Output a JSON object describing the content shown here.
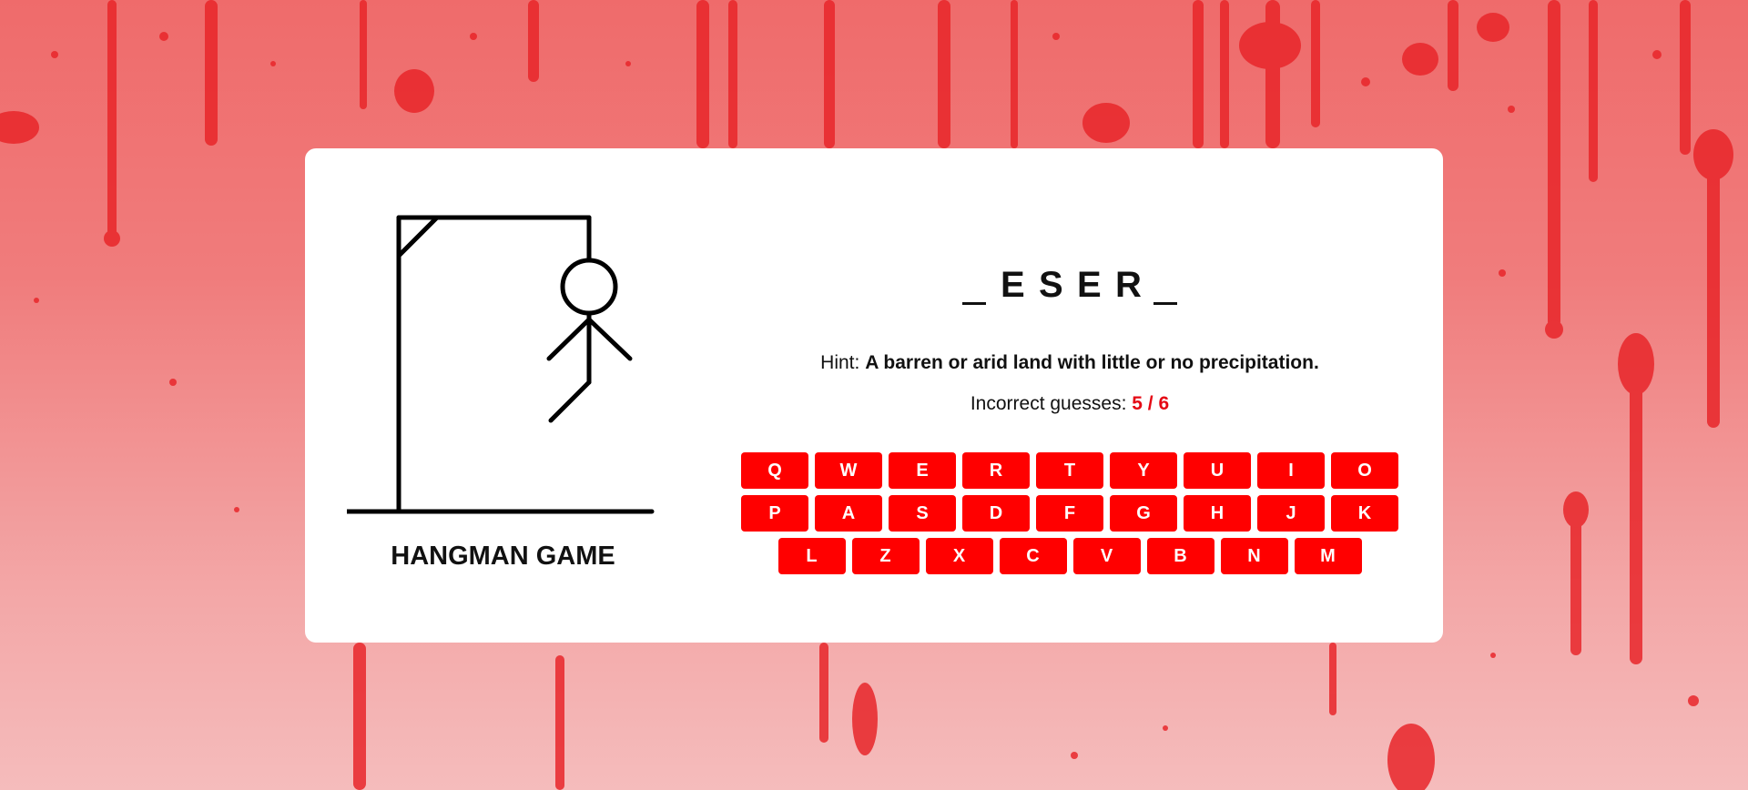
{
  "colors": {
    "accent": "#ff0000",
    "count_text": "#e50914",
    "background_splatter": "#e8262a"
  },
  "game": {
    "title": "HANGMAN GAME",
    "word_slots": [
      "",
      "E",
      "S",
      "E",
      "R",
      ""
    ],
    "hint_label": "Hint:",
    "hint_text": "A barren or arid land with little or no precipitation.",
    "incorrect_label": "Incorrect guesses:",
    "incorrect_count": "5 / 6",
    "incorrect_value": 5,
    "max_guesses": 6
  },
  "keyboard": {
    "rows": [
      [
        "Q",
        "W",
        "E",
        "R",
        "T",
        "Y",
        "U",
        "I",
        "O"
      ],
      [
        "P",
        "A",
        "S",
        "D",
        "F",
        "G",
        "H",
        "J",
        "K"
      ],
      [
        "L",
        "Z",
        "X",
        "C",
        "V",
        "B",
        "N",
        "M"
      ]
    ]
  }
}
